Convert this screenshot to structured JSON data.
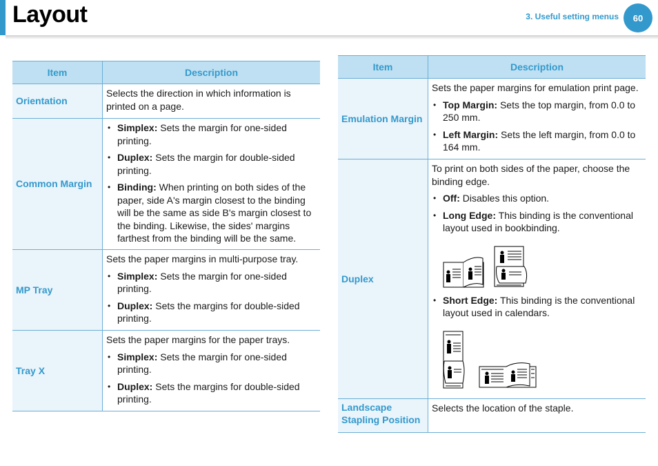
{
  "header": {
    "title": "Layout",
    "section": "3.  Useful setting menus",
    "page_number": "60"
  },
  "left_table": {
    "headers": [
      "Item",
      "Description"
    ],
    "rows": [
      {
        "item": "Orientation",
        "intro": "Selects the direction in which information is printed on a page.",
        "bullets": []
      },
      {
        "item": "Common Margin",
        "intro": "",
        "bullets": [
          {
            "term": "Simplex:",
            "text": " Sets the margin for one-sided printing."
          },
          {
            "term": "Duplex:",
            "text": " Sets the margin for double-sided printing."
          },
          {
            "term": "Binding:",
            "text": " When printing on both sides of the paper, side A's margin closest to the binding will be the same as side B's margin closest to the binding. Likewise, the sides' margins farthest from the binding will be the same."
          }
        ]
      },
      {
        "item": "MP Tray",
        "intro": "Sets the paper margins in multi-purpose tray.",
        "bullets": [
          {
            "term": "Simplex:",
            "text": " Sets the margin for one-sided printing."
          },
          {
            "term": "Duplex:",
            "text": " Sets the margins for double-sided printing."
          }
        ]
      },
      {
        "item": "Tray X",
        "intro": "Sets the paper margins for the paper trays.",
        "bullets": [
          {
            "term": "Simplex:",
            "text": " Sets the margin for one-sided printing."
          },
          {
            "term": "Duplex:",
            "text": " Sets the margins for double-sided printing."
          }
        ]
      }
    ]
  },
  "right_table": {
    "headers": [
      "Item",
      "Description"
    ],
    "rows": [
      {
        "item": "Emulation Margin",
        "intro": "Sets the paper margins for emulation print page.",
        "bullets": [
          {
            "term": "Top Margin:",
            "text": " Sets the top margin, from 0.0 to 250 mm."
          },
          {
            "term": "Left Margin:",
            "text": " Sets the left margin, from 0.0 to 164 mm."
          }
        ]
      },
      {
        "item": "Duplex",
        "intro": "To print on both sides of the paper, choose the binding edge.",
        "bullets": [
          {
            "term": "Off:",
            "text": " Disables this option."
          },
          {
            "term": "Long Edge:",
            "text": " This binding is the conventional layout used in bookbinding."
          },
          {
            "term": "Short Edge:",
            "text": " This binding is the conventional layout used in calendars."
          }
        ]
      },
      {
        "item": "Landscape Stapling Position",
        "intro": "Selects the location of the staple.",
        "bullets": []
      }
    ]
  },
  "colors": {
    "accent": "#3399cc",
    "header_bg": "#bfe0f2",
    "item_bg": "#eaf4fb"
  }
}
